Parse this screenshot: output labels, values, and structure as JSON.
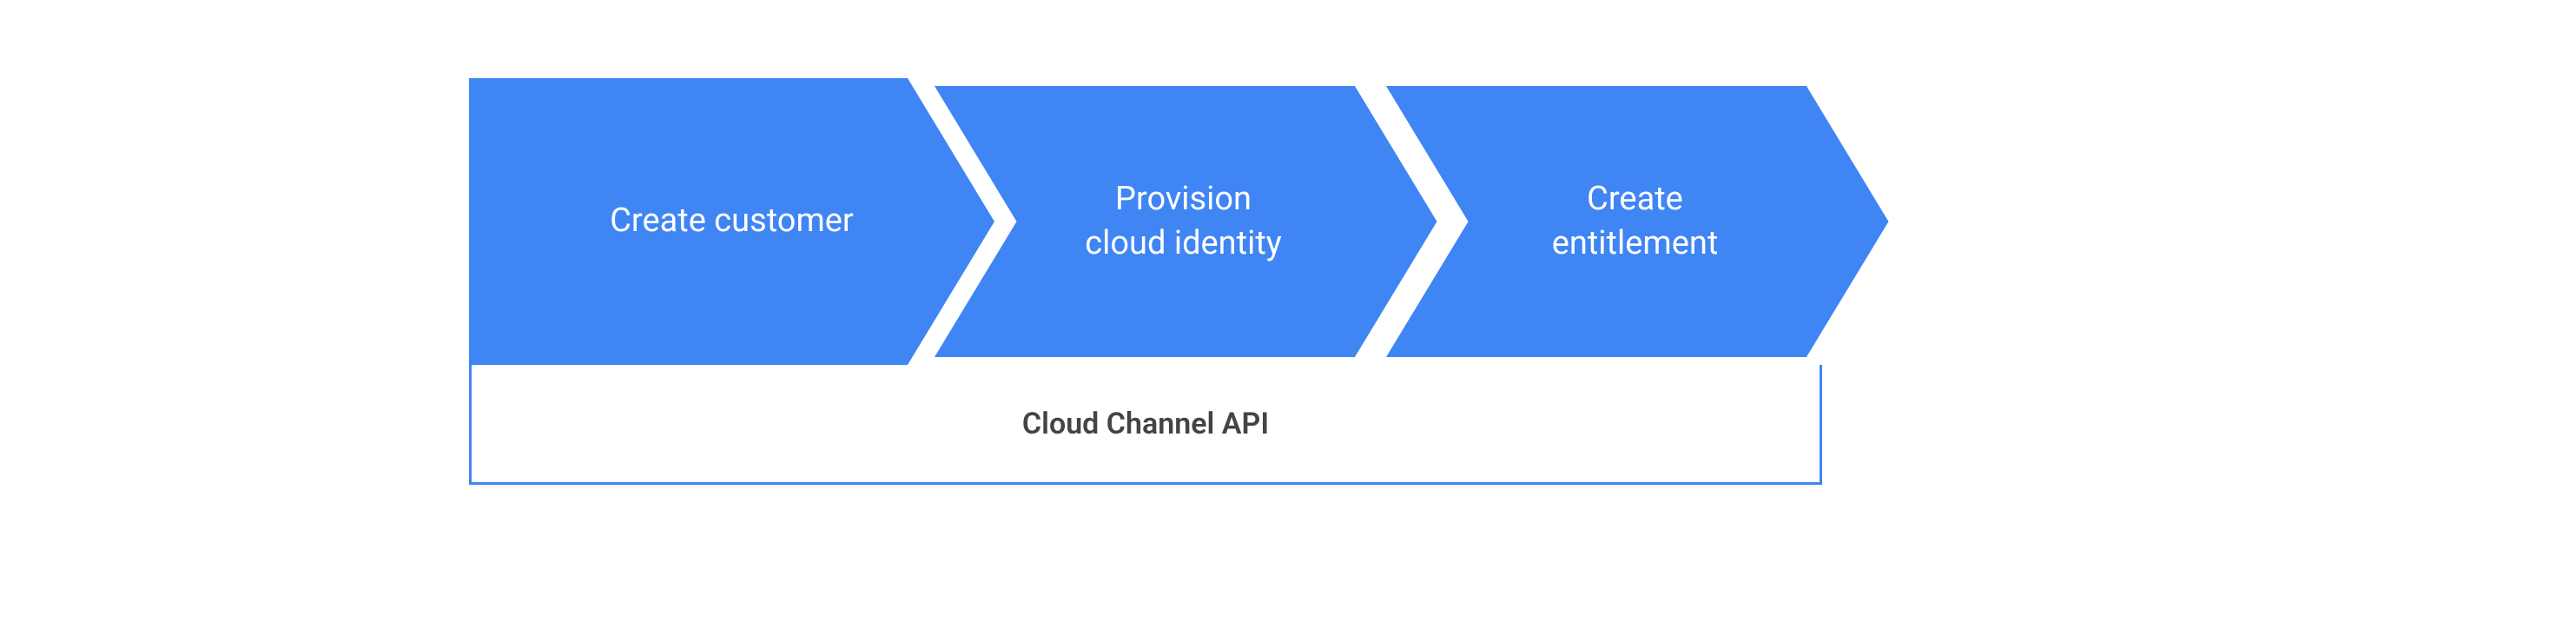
{
  "diagram": {
    "steps": [
      {
        "label": "Create customer"
      },
      {
        "label": "Provision\ncloud identity"
      },
      {
        "label": "Create\nentitlement"
      }
    ],
    "api_label": "Cloud Channel API",
    "colors": {
      "chevron_fill": "#3f85f4",
      "chevron_stroke": "#ffffff",
      "border": "#3f85f4"
    }
  }
}
